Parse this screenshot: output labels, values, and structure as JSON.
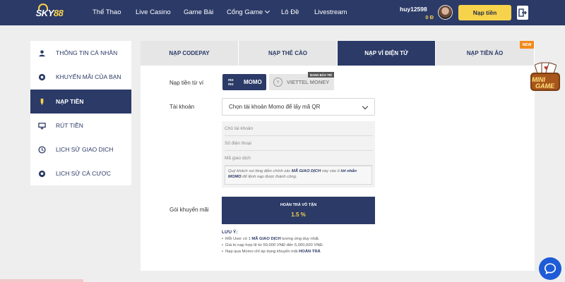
{
  "header": {
    "logo_text_1": "SKY",
    "logo_text_2": "88",
    "nav": [
      "Thể Thao",
      "Live Casino",
      "Game Bài",
      "Cổng Game",
      "Lô Đề",
      "Livestream"
    ],
    "username": "huy12598",
    "balance": "0 Đ",
    "deposit_label": "Nạp tiền",
    "icons": [
      "logout-icon",
      "chevron-down-icon"
    ]
  },
  "sidebar": {
    "items": [
      {
        "label": "THÔNG TIN CÁ NHÂN",
        "icon": "user-icon"
      },
      {
        "label": "KHUYẾN MÃI CỦA BẠN",
        "icon": "gift-icon"
      },
      {
        "label": "NẠP TIỀN",
        "icon": "deposit-icon",
        "active": true
      },
      {
        "label": "RÚT TIỀN",
        "icon": "withdraw-icon"
      },
      {
        "label": "LỊCH SỬ GIAO DỊCH",
        "icon": "history-icon"
      },
      {
        "label": "LỊCH SỬ CÁ CƯỢC",
        "icon": "ball-icon"
      }
    ]
  },
  "tabs": [
    {
      "label": "NẠP CODEPAY"
    },
    {
      "label": "NẠP THẺ CÀO"
    },
    {
      "label": "NẠP VÍ ĐIỆN TỬ",
      "active": true
    },
    {
      "label": "NẠP TIỀN ẢO"
    }
  ],
  "new_badge": "NEW",
  "form": {
    "wallet_label": "Nạp tiền từ ví",
    "momo_logo_1": "mo",
    "momo_logo_2": "mo",
    "momo": "MOMO",
    "viettel": "VIETTEL MONEY",
    "viettel_logo": "V",
    "maintenance": "ĐANG BẢO TRÌ",
    "account_label": "Tài khoản",
    "account_select": "Chọn tài khoản Momo để lấy mã QR",
    "owner_placeholder": "Chủ tài khoản",
    "phone_placeholder": "Số điện thoại",
    "code_placeholder": "Mã giao dịch",
    "note_1": "Quý khách vui lòng điền chính xác ",
    "note_code": "MÃ GIAO DỊCH",
    "note_2": " này vào ô ",
    "note_msg": "lời nhắn MOMO",
    "note_3": " để lệnh nạp được thành công.",
    "promo_label": "Gói khuyến mãi",
    "promo_title": "HOÀN TRẢ VÔ TẬN",
    "promo_value": "1.5 %"
  },
  "notes": {
    "title": "LƯU Ý:",
    "line1_a": "Mỗi User có 1 ",
    "line1_b": "MÃ GIAO DỊCH",
    "line1_c": " tương ứng duy nhất.",
    "line2": "Giá trị nạp hợp lệ từ 50,000 VNĐ đến 5,000,000 VNĐ.",
    "line3_a": "Nạp qua Momo chỉ áp dụng khuyến mãi ",
    "line3_b": "HOÀN TRẢ"
  },
  "floating": {
    "minigame_1": "MINI",
    "minigame_2": "GAME"
  },
  "colors": {
    "navy": "#2b3a67",
    "accent_yellow": "#f7d24b",
    "new_orange": "#f28a1d",
    "chat_blue": "#1e5bd6"
  }
}
